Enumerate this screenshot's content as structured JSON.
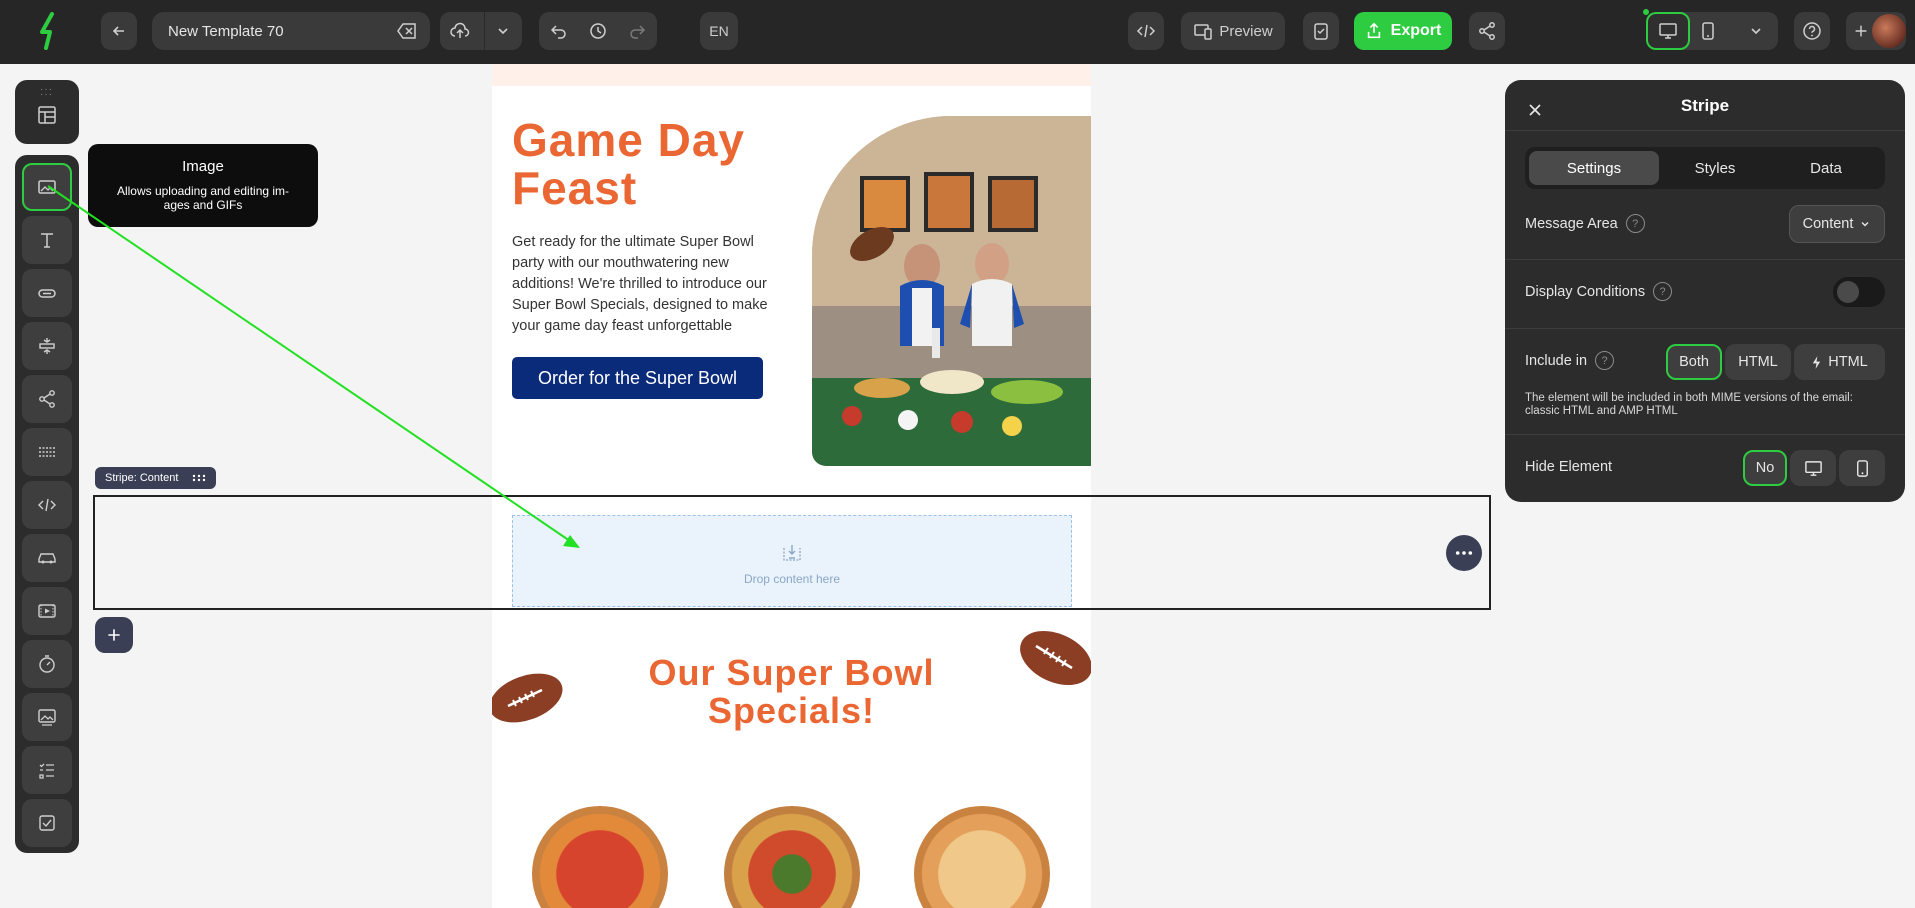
{
  "topbar": {
    "template_name": "New Template 70",
    "language": "EN",
    "preview_label": "Preview",
    "export_label": "Export"
  },
  "tooltip": {
    "title": "Image",
    "description": "Allows uploading and editing im-ages and GIFs"
  },
  "email": {
    "hero_title": "Game Day Feast",
    "hero_body": "Get ready for the ultimate Super Bowl party with our mouthwatering new additions! We're thrilled to introduce our Super Bowl Specials, designed to make your game day feast unforgettable",
    "cta_label": "Order for the Super Bowl",
    "drop_label": "Drop content here",
    "specials_title": "Our Super Bowl Specials!"
  },
  "stripe": {
    "label": "Stripe: Content"
  },
  "panel": {
    "title": "Stripe",
    "tabs": [
      {
        "label": "Settings",
        "active": true
      },
      {
        "label": "Styles",
        "active": false
      },
      {
        "label": "Data",
        "active": false
      }
    ],
    "message_area_label": "Message Area",
    "message_area_value": "Content",
    "display_conditions_label": "Display Conditions",
    "display_conditions_on": false,
    "include_in_label": "Include in",
    "include_options": [
      "Both",
      "HTML",
      "HTML"
    ],
    "include_selected": "Both",
    "include_note": "The element will be included in both MIME versions of the email: classic HTML and AMP HTML",
    "hide_element_label": "Hide Element",
    "hide_no_label": "No",
    "help_glyph": "?"
  },
  "colors": {
    "accent_green": "#2ecc40",
    "brand_orange": "#ea6632",
    "cta_navy": "#0a2a7a",
    "toolbar_dark": "#262626"
  }
}
